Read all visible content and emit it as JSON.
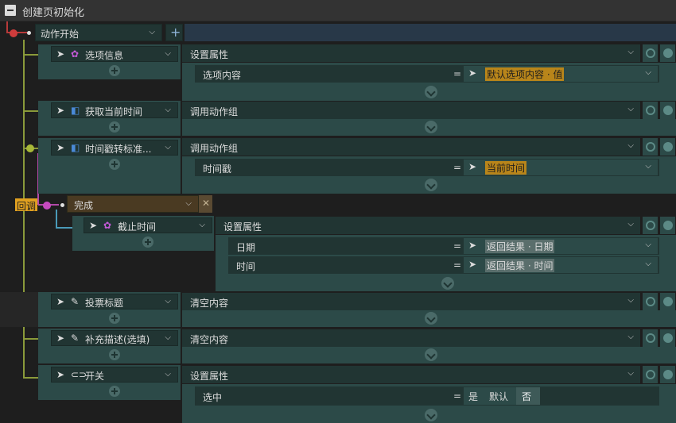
{
  "title": "创建页初始化",
  "root": {
    "label": "动作开始",
    "add": "+"
  },
  "callback_label": "回调",
  "done_label": "完成",
  "actions": [
    {
      "name": "选项信息",
      "type": "设置属性",
      "props": [
        {
          "label": "选项内容",
          "eq": "=",
          "value": "默认选项内容 · 值"
        }
      ]
    },
    {
      "name": "获取当前时间",
      "type": "调用动作组",
      "props": []
    },
    {
      "name": "时间戳转标准...",
      "type": "调用动作组",
      "props": [
        {
          "label": "时间戳",
          "eq": "=",
          "value": "当前时间"
        }
      ]
    },
    {
      "name": "投票标题",
      "type": "清空内容",
      "props": []
    },
    {
      "name": "补充描述(选填)",
      "type": "清空内容",
      "props": []
    },
    {
      "name": "开关",
      "type": "设置属性",
      "props": [
        {
          "label": "选中",
          "eq": "=",
          "options": [
            "是",
            "默认",
            "否"
          ]
        }
      ]
    }
  ],
  "nested": {
    "name": "截止时间",
    "type": "设置属性",
    "props": [
      {
        "label": "日期",
        "eq": "=",
        "value": "返回结果 · 日期"
      },
      {
        "label": "时间",
        "eq": "=",
        "value": "返回结果 · 时间"
      }
    ]
  },
  "colors": {
    "bg": "#1e1e1e",
    "panel": "#2c4a48",
    "panel_dark": "#213533",
    "highlight": "#b8851a",
    "callback": "#e0a020"
  }
}
